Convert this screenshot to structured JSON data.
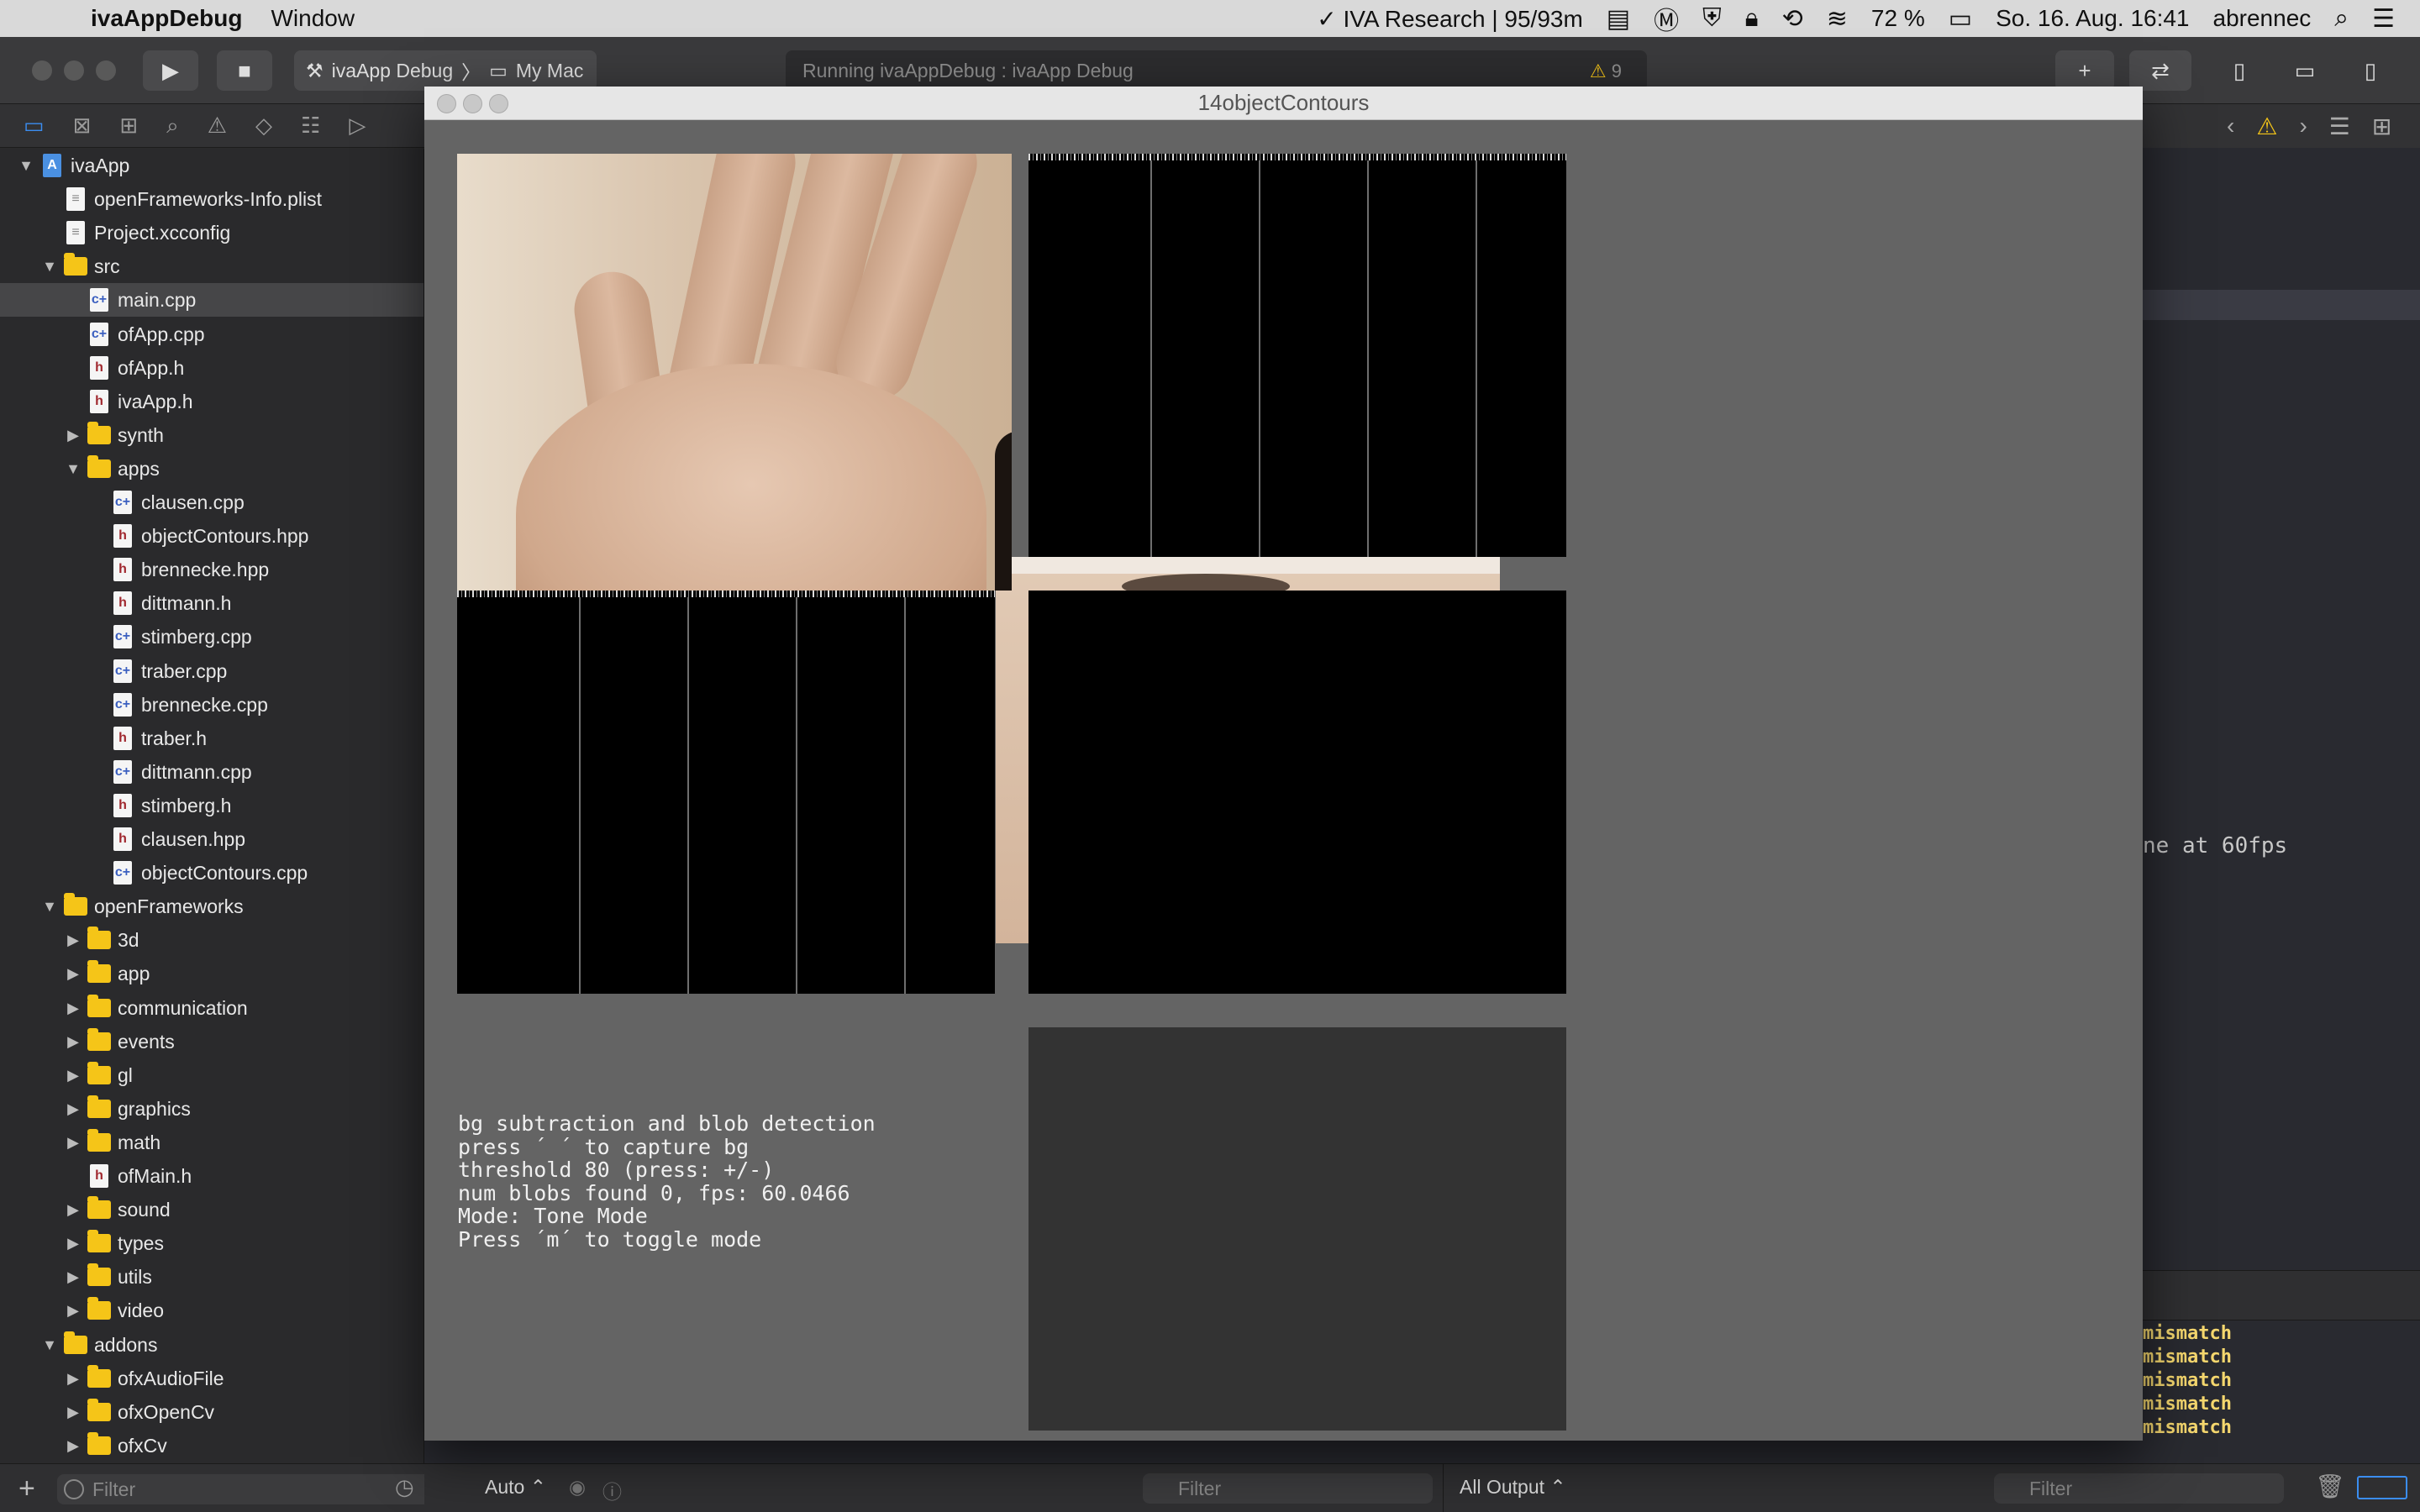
{
  "menubar": {
    "app_name": "ivaAppDebug",
    "menus": [
      "Window"
    ],
    "status": {
      "vpn": "✓ IVA Research | 95/93m",
      "battery": "72 %",
      "datetime": "So. 16. Aug.  16:41",
      "user": "abrennec"
    }
  },
  "toolbar": {
    "scheme": "ivaApp Debug",
    "destination": "My Mac",
    "activity": "Running ivaAppDebug : ivaApp Debug",
    "warning_count": "9"
  },
  "navigator": {
    "items": [
      {
        "label": "ivaApp",
        "kind": "proj",
        "depth": 0,
        "disclosure": "open"
      },
      {
        "label": "openFrameworks-Info.plist",
        "kind": "plist",
        "depth": 1,
        "disclosure": ""
      },
      {
        "label": "Project.xcconfig",
        "kind": "plist",
        "depth": 1,
        "disclosure": ""
      },
      {
        "label": "src",
        "kind": "folder",
        "depth": 1,
        "disclosure": "open"
      },
      {
        "label": "main.cpp",
        "kind": "cpp",
        "depth": 2,
        "disclosure": "",
        "selected": true
      },
      {
        "label": "ofApp.cpp",
        "kind": "cpp",
        "depth": 2,
        "disclosure": ""
      },
      {
        "label": "ofApp.h",
        "kind": "h",
        "depth": 2,
        "disclosure": ""
      },
      {
        "label": "ivaApp.h",
        "kind": "h",
        "depth": 2,
        "disclosure": ""
      },
      {
        "label": "synth",
        "kind": "folder",
        "depth": 2,
        "disclosure": "closed"
      },
      {
        "label": "apps",
        "kind": "folder",
        "depth": 2,
        "disclosure": "open"
      },
      {
        "label": "clausen.cpp",
        "kind": "cpp",
        "depth": 3,
        "disclosure": ""
      },
      {
        "label": "objectContours.hpp",
        "kind": "h",
        "depth": 3,
        "disclosure": ""
      },
      {
        "label": "brennecke.hpp",
        "kind": "h",
        "depth": 3,
        "disclosure": ""
      },
      {
        "label": "dittmann.h",
        "kind": "h",
        "depth": 3,
        "disclosure": ""
      },
      {
        "label": "stimberg.cpp",
        "kind": "cpp",
        "depth": 3,
        "disclosure": ""
      },
      {
        "label": "traber.cpp",
        "kind": "cpp",
        "depth": 3,
        "disclosure": ""
      },
      {
        "label": "brennecke.cpp",
        "kind": "cpp",
        "depth": 3,
        "disclosure": ""
      },
      {
        "label": "traber.h",
        "kind": "h",
        "depth": 3,
        "disclosure": ""
      },
      {
        "label": "dittmann.cpp",
        "kind": "cpp",
        "depth": 3,
        "disclosure": ""
      },
      {
        "label": "stimberg.h",
        "kind": "h",
        "depth": 3,
        "disclosure": ""
      },
      {
        "label": "clausen.hpp",
        "kind": "h",
        "depth": 3,
        "disclosure": ""
      },
      {
        "label": "objectContours.cpp",
        "kind": "cpp",
        "depth": 3,
        "disclosure": ""
      },
      {
        "label": "openFrameworks",
        "kind": "folder",
        "depth": 1,
        "disclosure": "open"
      },
      {
        "label": "3d",
        "kind": "folder",
        "depth": 2,
        "disclosure": "closed"
      },
      {
        "label": "app",
        "kind": "folder",
        "depth": 2,
        "disclosure": "closed"
      },
      {
        "label": "communication",
        "kind": "folder",
        "depth": 2,
        "disclosure": "closed"
      },
      {
        "label": "events",
        "kind": "folder",
        "depth": 2,
        "disclosure": "closed"
      },
      {
        "label": "gl",
        "kind": "folder",
        "depth": 2,
        "disclosure": "closed"
      },
      {
        "label": "graphics",
        "kind": "folder",
        "depth": 2,
        "disclosure": "closed"
      },
      {
        "label": "math",
        "kind": "folder",
        "depth": 2,
        "disclosure": "closed"
      },
      {
        "label": "ofMain.h",
        "kind": "h",
        "depth": 2,
        "disclosure": ""
      },
      {
        "label": "sound",
        "kind": "folder",
        "depth": 2,
        "disclosure": "closed"
      },
      {
        "label": "types",
        "kind": "folder",
        "depth": 2,
        "disclosure": "closed"
      },
      {
        "label": "utils",
        "kind": "folder",
        "depth": 2,
        "disclosure": "closed"
      },
      {
        "label": "video",
        "kind": "folder",
        "depth": 2,
        "disclosure": "closed"
      },
      {
        "label": "addons",
        "kind": "folder",
        "depth": 1,
        "disclosure": "open"
      },
      {
        "label": "ofxAudioFile",
        "kind": "folder",
        "depth": 2,
        "disclosure": "closed"
      },
      {
        "label": "ofxOpenCv",
        "kind": "folder",
        "depth": 2,
        "disclosure": "closed"
      },
      {
        "label": "ofxCv",
        "kind": "folder",
        "depth": 2,
        "disclosure": "closed"
      }
    ],
    "filter_placeholder": "Filter"
  },
  "editor": {
    "code_fragment": "ne at 60fps",
    "console_lines": [
      "mismatch",
      "mismatch",
      "mismatch",
      "mismatch",
      "mismatch"
    ]
  },
  "debugbar": {
    "variables_scope": "Auto ⌃",
    "filter_left": "Filter",
    "output_scope": "All Output ⌃",
    "filter_right": "Filter"
  },
  "ofwindow": {
    "title": "14objectContours",
    "info_lines": [
      "bg subtraction and blob detection",
      "press ´ ´ to capture bg",
      "threshold 80 (press: +/-)",
      "num blobs found 0, fps: 60.0466",
      "Mode: Tone Mode",
      "Press ´m´ to toggle mode"
    ]
  }
}
